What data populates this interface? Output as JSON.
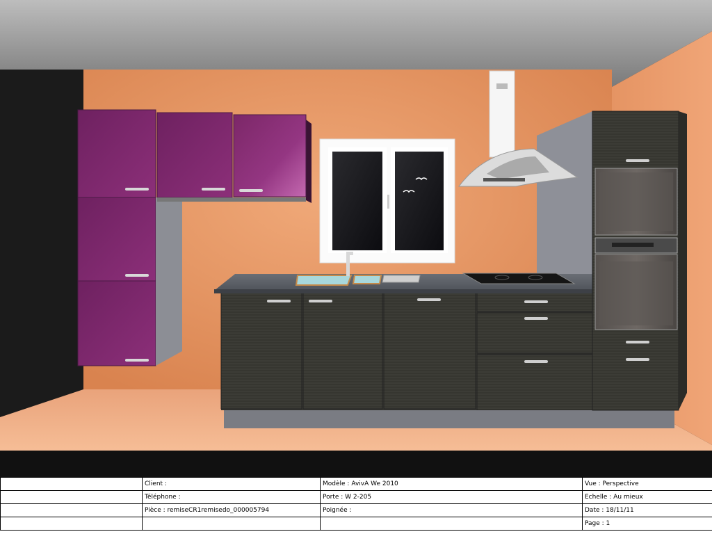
{
  "info_table": {
    "client": "Client :",
    "telephone": "Téléphone :",
    "piece": "Pièce : remiseCR1remisedo_000005794",
    "modele": "Modèle : AvivA We 2010",
    "porte": "Porte : W 2-205",
    "poignee": "Poignée :",
    "vue": "Vue : Perspective",
    "echelle": "Echelle : Au mieux",
    "date": "Date : 18/11/11",
    "page": "Page : 1"
  },
  "colors": {
    "wall_orange": "#e08f5d",
    "floor_peach": "#f2b088",
    "ceiling_grey": "#9a9a9a",
    "cabinet_purple": "#8a2f78",
    "cabinet_dark_wood": "#3a3a35",
    "countertop_grey": "#5d6168",
    "window_frame": "#ffffff",
    "hood_white": "#f4f4f4"
  },
  "scene": {
    "view": "3D kitchen perspective render",
    "icons": [
      "wall-cabinet",
      "tall-cabinet",
      "sink",
      "faucet",
      "cooktop",
      "range-hood",
      "window",
      "oven",
      "microwave-oven",
      "drawer-handle"
    ]
  }
}
